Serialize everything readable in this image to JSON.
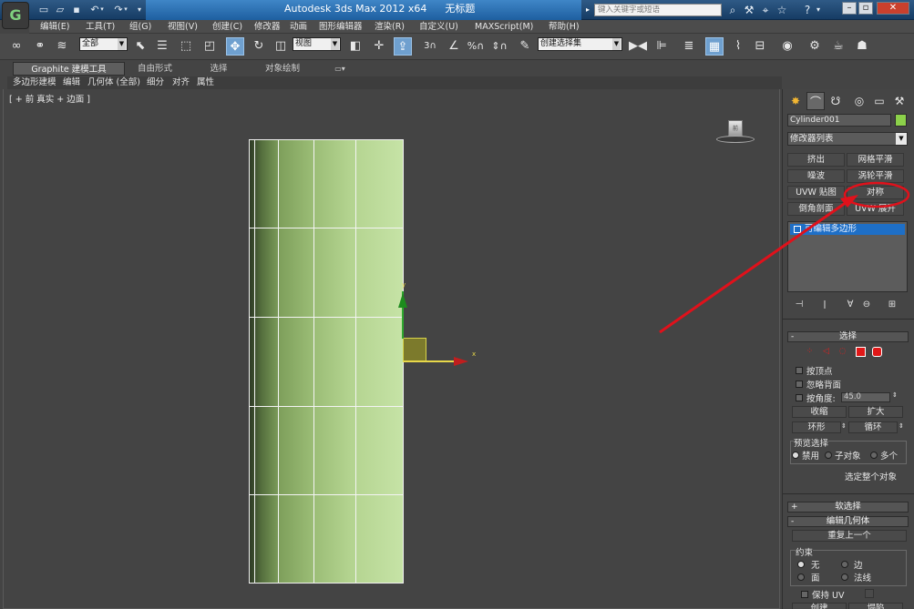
{
  "app": {
    "title": "Autodesk 3ds Max  2012 x64",
    "doc": "无标题",
    "search_placeholder": "键入关键字或短语",
    "logo": "app-logo-icon"
  },
  "menu": [
    "编辑(E)",
    "工具(T)",
    "组(G)",
    "视图(V)",
    "创建(C)",
    "修改器",
    "动画",
    "图形编辑器",
    "渲染(R)",
    "自定义(U)",
    "MAXScript(M)",
    "帮助(H)"
  ],
  "toolbar": {
    "selection_filter": "全部",
    "ref_coord": "视图",
    "named_selection": "创建选择集"
  },
  "ribbon": {
    "tabs": [
      "Graphite 建模工具",
      "自由形式",
      "选择",
      "对象绘制"
    ],
    "subtabs": [
      "多边形建模",
      "编辑",
      "几何体 (全部)",
      "细分",
      "对齐",
      "属性"
    ]
  },
  "viewport": {
    "label": "[ + 前 真实 + 边面 ]",
    "cube_face": "前",
    "axis_x": "x",
    "axis_y": "y"
  },
  "panel": {
    "object_name": "Cylinder001",
    "object_color": "#8cd14a",
    "modifier_list": "修改器列表",
    "modifier_buttons": [
      "挤出",
      "网格平滑",
      "噪波",
      "涡轮平滑",
      "UVW 贴图",
      "对称",
      "倒角剖面",
      "UVW 展开"
    ],
    "stack_item": "可编辑多边形",
    "rollouts": {
      "selection": "选择",
      "by_vertex": "按顶点",
      "ignore_backfacing": "忽略背面",
      "by_angle": "按角度:",
      "angle_value": "45.0",
      "shrink": "收缩",
      "grow": "扩大",
      "ring": "环形",
      "loop": "循环",
      "preview_selection": "预览选择",
      "disabled": "禁用",
      "sub_object": "子对象",
      "multi": "多个",
      "whole_object_selected": "选定整个对象",
      "soft_selection": "软选择",
      "edit_geometry": "编辑几何体",
      "repeat_last": "重复上一个",
      "constraints": "约束",
      "none": "无",
      "edge": "边",
      "face": "面",
      "normal": "法线",
      "preserve_uv": "保持 UV",
      "create": "创建",
      "collapse": "塌陷"
    }
  },
  "annotation": {
    "color": "#e0111b"
  }
}
